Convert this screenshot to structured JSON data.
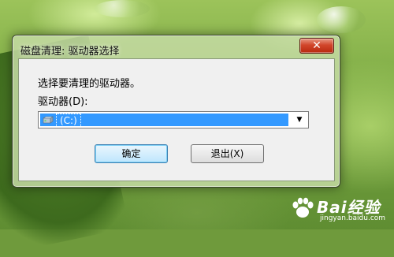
{
  "dialog": {
    "title": "磁盘清理: 驱动器选择",
    "prompt": "选择要清理的驱动器。",
    "drive_label": "驱动器(D):",
    "drive_selected": "(C:)",
    "ok_label": "确定",
    "exit_label": "退出(X)",
    "close_glyph": "✕"
  },
  "watermark": {
    "brand": "Bai经验",
    "url": "jingyan.baidu.com"
  },
  "colors": {
    "selection": "#3399ff",
    "close_button": "#c7351c"
  }
}
